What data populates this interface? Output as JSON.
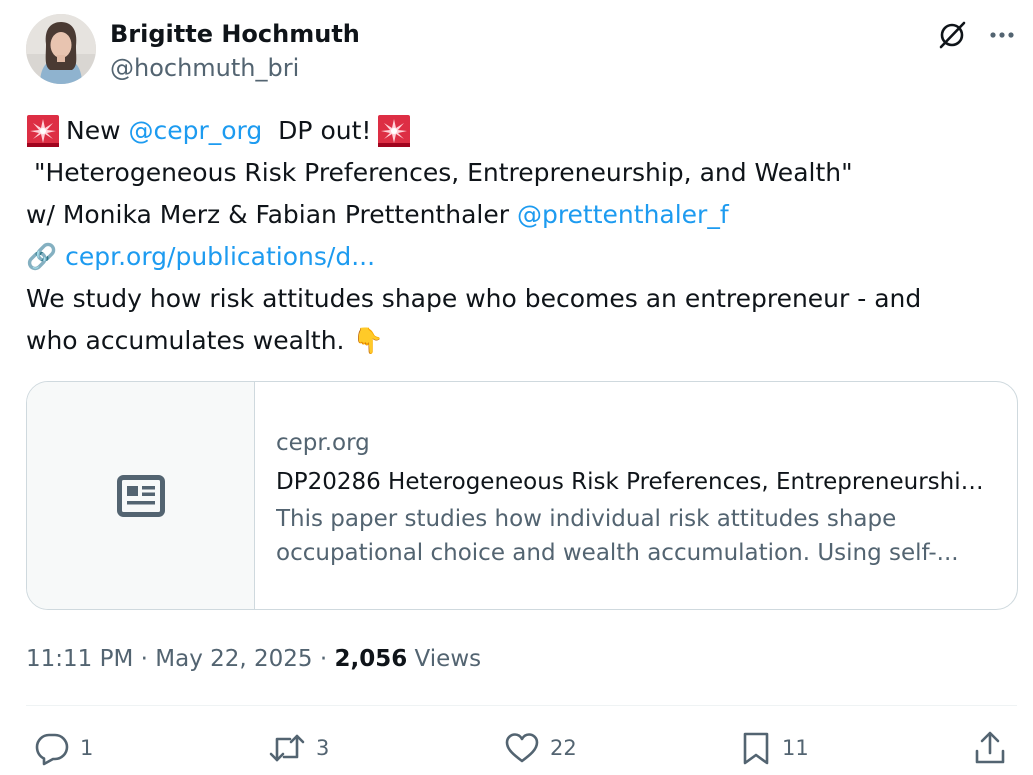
{
  "author": {
    "name": "Brigitte Hochmuth",
    "handle": "@hochmuth_bri"
  },
  "tweet": {
    "line1": {
      "prefix": "New",
      "mention": "@cepr_org",
      "suffix": "DP out!"
    },
    "line2": " \"Heterogeneous Risk Preferences, Entrepreneurship, and Wealth\"",
    "line3": {
      "text": "w/ Monika Merz & Fabian Prettenthaler",
      "mention": "@prettenthaler_f"
    },
    "line4": {
      "link_emoji": "🔗",
      "link": "cepr.org/publications/d..."
    },
    "line5": "We study how risk attitudes shape who becomes an entrepreneur - and",
    "line6": {
      "text": "who accumulates wealth.",
      "emoji": "👇"
    }
  },
  "card": {
    "domain": "cepr.org",
    "title": "DP20286 Heterogeneous Risk Preferences, Entrepreneurship...",
    "description_line1": "This paper studies how individual risk attitudes shape",
    "description_line2": "occupational choice and wealth accumulation. Using self-..."
  },
  "meta": {
    "time": "11:11 PM",
    "separator": " · ",
    "date": "May 22, 2025",
    "views_count": "2,056",
    "views_label": " Views"
  },
  "actions": {
    "replies": "1",
    "reposts": "3",
    "likes": "22",
    "bookmarks": "11"
  },
  "colors": {
    "text": "#0f1419",
    "secondary": "#536471",
    "link": "#1d9bf0",
    "border": "#cfd9de"
  }
}
